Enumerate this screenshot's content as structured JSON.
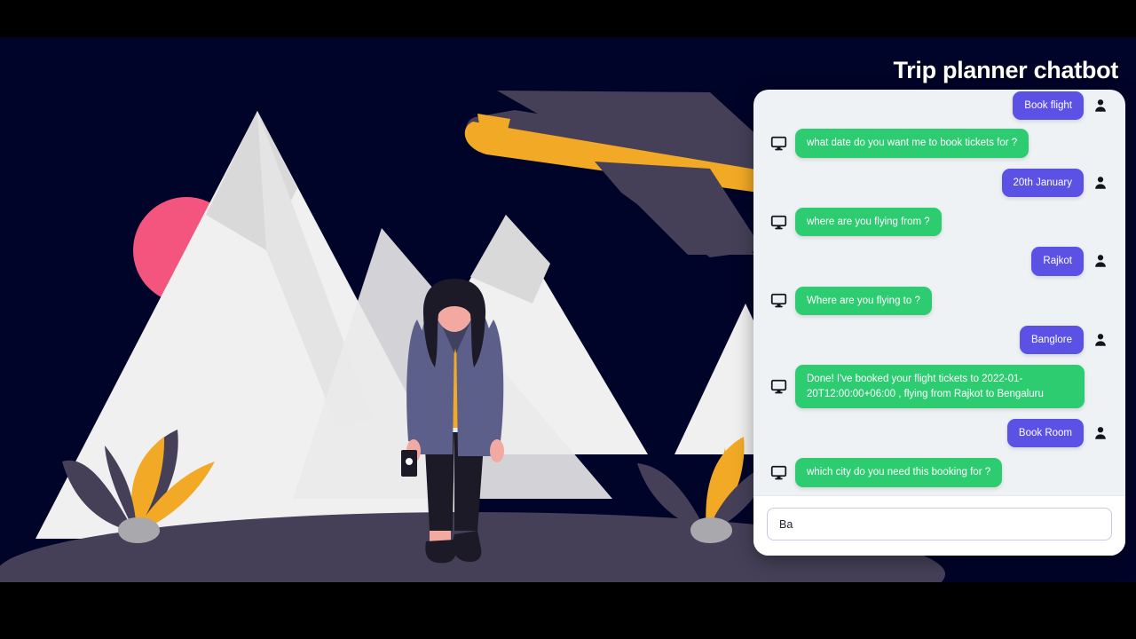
{
  "page": {
    "title": "Trip planner chatbot",
    "background_color": "#000428",
    "letterbox_color": "#000000"
  },
  "illustration": {
    "name": "traveler-mountains-airplane",
    "colors": {
      "sky": "#000428",
      "mountain": "#f0f0f0",
      "mountain_shade": "#d9d9d9",
      "sun": "#f4557f",
      "ground": "#454058",
      "plane_body": "#454058",
      "plane_belly": "#f2a925",
      "leaf_dark": "#454058",
      "leaf_orange": "#f2a925",
      "rock": "#a8a8ad",
      "coat": "#5c5f8a",
      "top": "#f2a925",
      "hair": "#1b1a26",
      "skin": "#f2a9a1",
      "pants": "#1b1a26"
    }
  },
  "chat": {
    "panel_background": "#eff2f4",
    "bot_bubble_color": "#2ecc71",
    "user_bubble_color": "#5b52e5",
    "messages": [
      {
        "sender": "user",
        "text": "Book flight",
        "icon": "user-icon"
      },
      {
        "sender": "bot",
        "text": "what date do you want me to book tickets for ?",
        "icon": "monitor-icon"
      },
      {
        "sender": "user",
        "text": "20th January",
        "icon": "user-icon"
      },
      {
        "sender": "bot",
        "text": "where are you flying from ?",
        "icon": "monitor-icon"
      },
      {
        "sender": "user",
        "text": "Rajkot",
        "icon": "user-icon"
      },
      {
        "sender": "bot",
        "text": "Where are you flying to ?",
        "icon": "monitor-icon"
      },
      {
        "sender": "user",
        "text": "Banglore",
        "icon": "user-icon"
      },
      {
        "sender": "bot",
        "text": "Done! I've booked your flight tickets to 2022-01-20T12:00:00+06:00 , flying from Rajkot to Bengaluru",
        "icon": "monitor-icon"
      },
      {
        "sender": "user",
        "text": "Book Room",
        "icon": "user-icon"
      },
      {
        "sender": "bot",
        "text": "which city do you need this booking for ?",
        "icon": "monitor-icon"
      }
    ]
  },
  "composer": {
    "input_value": "Ba",
    "input_placeholder": ""
  }
}
